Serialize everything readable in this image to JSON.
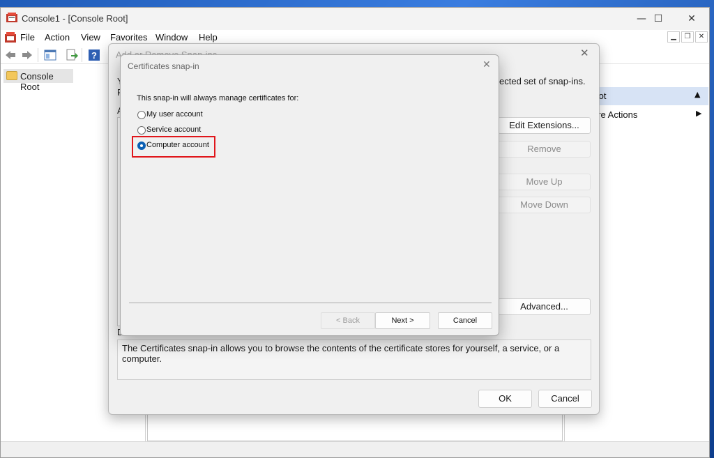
{
  "window": {
    "title": "Console1 - [Console Root]",
    "minimize_glyph": "—",
    "maximize_glyph": "☐",
    "close_glyph": "✕"
  },
  "menu": {
    "items": [
      "File",
      "Action",
      "View",
      "Favorites",
      "Window",
      "Help"
    ],
    "mdi_min": "▁",
    "mdi_restore": "❐",
    "mdi_close": "✕"
  },
  "toolbar": {
    "icons": [
      "back-arrow-icon",
      "forward-arrow-icon",
      "show-hide-tree-icon",
      "export-list-icon",
      "help-icon"
    ]
  },
  "tree": {
    "root_label": "Console Root"
  },
  "actions": {
    "header": "Root",
    "header_arrow": "▲",
    "more": "ore Actions",
    "more_arrow": "▶"
  },
  "snapin_dialog": {
    "title": "Add or Remove Snap-ins",
    "close_glyph": "✕",
    "intro_visible_fragment": "ected set of snap-ins.",
    "left_fragment_1": "Y",
    "left_fragment_2": "F",
    "left_fragment_3": "A",
    "left_fragment_4": "D",
    "buttons": {
      "edit_extensions": "Edit Extensions...",
      "remove": "Remove",
      "move_up": "Move Up",
      "move_down": "Move Down",
      "advanced": "Advanced..."
    },
    "description": "The Certificates snap-in allows you to browse the contents of the certificate stores for yourself, a service, or a computer.",
    "ok": "OK",
    "cancel": "Cancel"
  },
  "cert_dialog": {
    "title": "Certificates snap-in",
    "close_glyph": "✕",
    "prompt": "This snap-in will always manage certificates for:",
    "options": [
      {
        "label": "My user account",
        "selected": false
      },
      {
        "label": "Service account",
        "selected": false
      },
      {
        "label": "Computer account",
        "selected": true
      }
    ],
    "back": "< Back",
    "next": "Next >",
    "cancel": "Cancel"
  },
  "colors": {
    "accent": "#0a5fb4",
    "highlight_border": "#e0161b",
    "actions_header_bg": "#d7e3f5"
  }
}
